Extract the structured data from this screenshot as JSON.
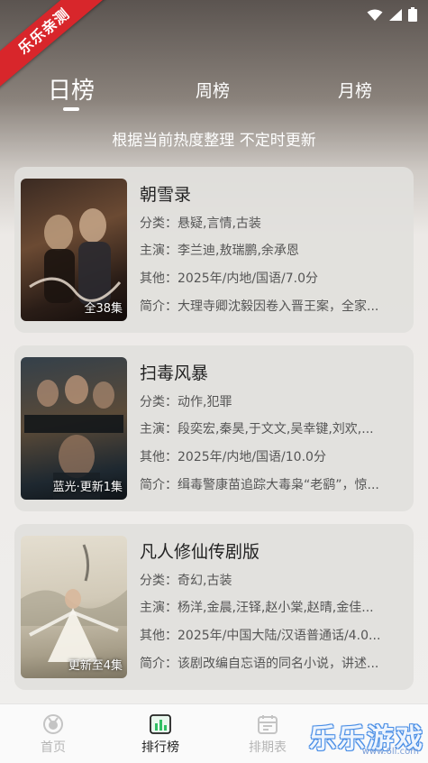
{
  "corner_badge": "乐乐亲测",
  "tabs": [
    {
      "label": "日榜",
      "active": true
    },
    {
      "label": "周榜",
      "active": false
    },
    {
      "label": "月榜",
      "active": false
    }
  ],
  "subtitle": "根据当前热度整理 不定时更新",
  "shows": [
    {
      "title": "朝雪录",
      "genre": "分类：悬疑,言情,古装",
      "cast": "主演：李兰迪,敖瑞鹏,余承恩",
      "other": "其他：2025年/内地/国语/7.0分",
      "intro": "简介：大理寺卿沈毅因卷入晋王案，全家...",
      "badge": "全38集",
      "poster_colors": [
        "#2a1d17",
        "#6b4a33",
        "#1a1210"
      ]
    },
    {
      "title": "扫毒风暴",
      "genre": "分类：动作,犯罪",
      "cast": "主演：段奕宏,秦昊,于文文,吴幸键,刘欢,...",
      "other": "其他：2025年/内地/国语/10.0分",
      "intro": "简介：缉毒警康苗追踪大毒枭“老鹞”，惊...",
      "badge": "蓝光·更新1集",
      "poster_colors": [
        "#1e2830",
        "#5a4a38",
        "#26323a"
      ]
    },
    {
      "title": "凡人修仙传剧版",
      "genre": "分类：奇幻,古装",
      "cast": "主演：杨洋,金晨,汪铎,赵小棠,赵晴,金佳...",
      "other": "其他：2025年/中国大陆/汉语普通话/4.0...",
      "intro": "简介：该剧改编自忘语的同名小说，讲述...",
      "badge": "更新至4集",
      "poster_colors": [
        "#d9d3c4",
        "#bcb3a0",
        "#8e8672"
      ]
    }
  ],
  "nav": [
    {
      "label": "首页",
      "icon": "home-icon",
      "active": false
    },
    {
      "label": "排行榜",
      "icon": "ranking-chart-icon",
      "active": true
    },
    {
      "label": "排期表",
      "icon": "calendar-icon",
      "active": false
    }
  ],
  "watermark": {
    "text": "乐乐游戏",
    "url": "www.6ll.com"
  }
}
